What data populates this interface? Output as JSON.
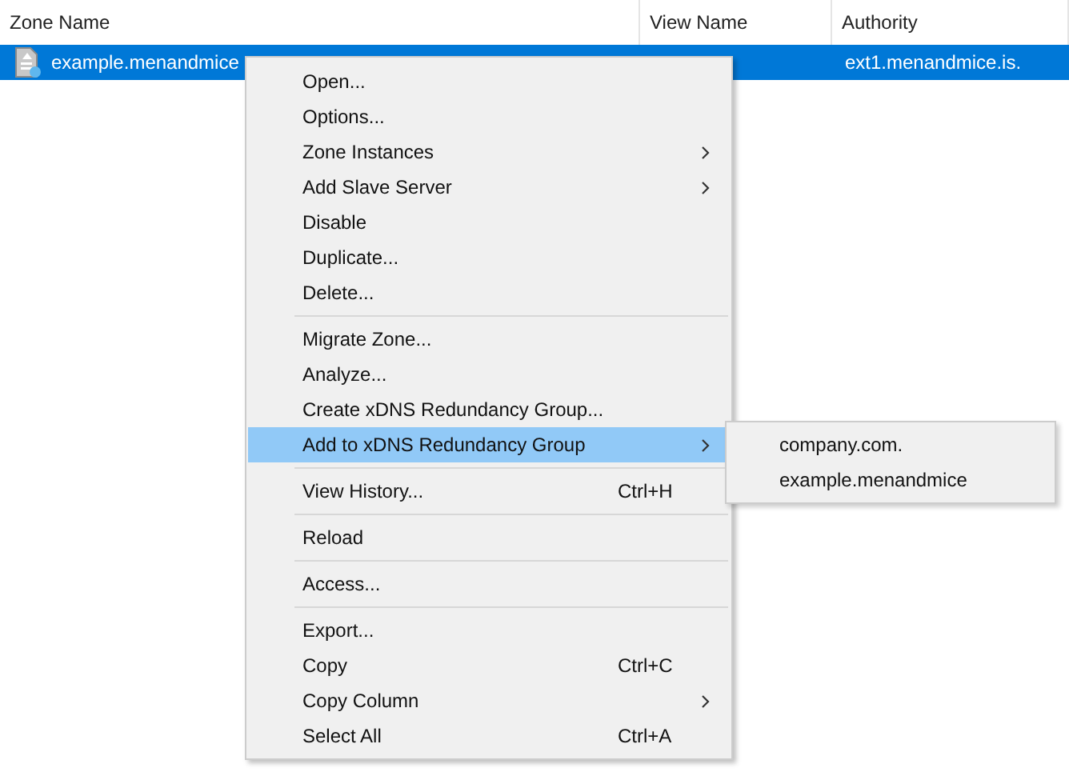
{
  "table": {
    "columns": [
      {
        "label": "Zone Name"
      },
      {
        "label": "View Name"
      },
      {
        "label": "Authority"
      }
    ],
    "rows": [
      {
        "selected": true,
        "zone_name": "example.menandmice",
        "authority": "ext1.menandmice.is."
      }
    ]
  },
  "context_menu": {
    "items": [
      {
        "kind": "item",
        "label": "Open...",
        "highlighted": false
      },
      {
        "kind": "item",
        "label": "Options...",
        "highlighted": false
      },
      {
        "kind": "item",
        "label": "Zone Instances",
        "submenu": true,
        "highlighted": false
      },
      {
        "kind": "item",
        "label": "Add Slave Server",
        "submenu": true,
        "highlighted": false
      },
      {
        "kind": "item",
        "label": "Disable",
        "highlighted": false
      },
      {
        "kind": "item",
        "label": "Duplicate...",
        "highlighted": false
      },
      {
        "kind": "item",
        "label": "Delete...",
        "highlighted": false
      },
      {
        "kind": "separator"
      },
      {
        "kind": "item",
        "label": "Migrate Zone...",
        "highlighted": false
      },
      {
        "kind": "item",
        "label": "Analyze...",
        "highlighted": false
      },
      {
        "kind": "item",
        "label": "Create xDNS Redundancy Group...",
        "highlighted": false
      },
      {
        "kind": "item",
        "label": "Add to xDNS Redundancy Group",
        "submenu": true,
        "highlighted": true
      },
      {
        "kind": "separator"
      },
      {
        "kind": "item",
        "label": "View History...",
        "shortcut": "Ctrl+H",
        "highlighted": false
      },
      {
        "kind": "separator"
      },
      {
        "kind": "item",
        "label": "Reload",
        "highlighted": false
      },
      {
        "kind": "separator"
      },
      {
        "kind": "item",
        "label": "Access...",
        "highlighted": false
      },
      {
        "kind": "separator"
      },
      {
        "kind": "item",
        "label": "Export...",
        "highlighted": false
      },
      {
        "kind": "item",
        "label": "Copy",
        "shortcut": "Ctrl+C",
        "highlighted": false
      },
      {
        "kind": "item",
        "label": "Copy Column",
        "submenu": true,
        "highlighted": false
      },
      {
        "kind": "item",
        "label": "Select All",
        "shortcut": "Ctrl+A",
        "highlighted": false
      }
    ]
  },
  "submenu": {
    "items": [
      {
        "label": "company.com."
      },
      {
        "label": "example.menandmice"
      }
    ]
  }
}
